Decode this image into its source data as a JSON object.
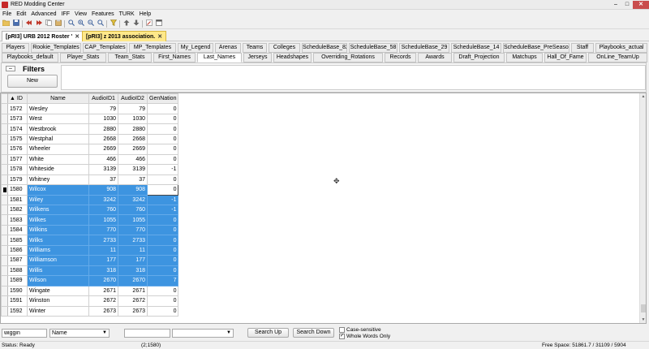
{
  "window": {
    "title": "RED Modding Center",
    "minimize": "–",
    "maximize": "□",
    "close": "✕"
  },
  "menu": [
    "File",
    "Edit",
    "Advanced",
    "IFF",
    "View",
    "Features",
    "TURK",
    "Help"
  ],
  "doc_tabs": [
    {
      "label": "[pRI3] URB 2012 Roster '",
      "close": "✕"
    },
    {
      "label": "[pRI3] z 2013 association.",
      "close": "✕"
    }
  ],
  "tabs_row1": [
    "Players",
    "Rookie_Templates",
    "CAP_Templates",
    "MP_Templates",
    "My_Legend",
    "Arenas",
    "Teams",
    "Colleges",
    "ScheduleBase_82",
    "ScheduleBase_58",
    "ScheduleBase_29",
    "ScheduleBase_14",
    "ScheduleBase_PreSeason",
    "Staff",
    "Playbooks_actual"
  ],
  "tabs_row2": [
    "Playbooks_default",
    "Player_Stats",
    "Team_Stats",
    "First_Names",
    "Last_Names",
    "Jerseys",
    "Headshapes",
    "Overriding_Rotations",
    "Records",
    "Awards",
    "Draft_Projection",
    "Matchups",
    "Hall_Of_Fame",
    "OnLine_TeamUp"
  ],
  "filters": {
    "collapse": "–",
    "label": "Filters",
    "new_button": "New"
  },
  "grid": {
    "sort_indicator": "▲",
    "columns": [
      "ID",
      "Name",
      "AudioID1",
      "AudioID2",
      "GenNation"
    ],
    "rows": [
      {
        "id": "1572",
        "name": "Wesley",
        "a1": "79",
        "a2": "79",
        "gn": "0"
      },
      {
        "id": "1573",
        "name": "West",
        "a1": "1030",
        "a2": "1030",
        "gn": "0"
      },
      {
        "id": "1574",
        "name": "Westbrook",
        "a1": "2880",
        "a2": "2880",
        "gn": "0"
      },
      {
        "id": "1575",
        "name": "Westphal",
        "a1": "2668",
        "a2": "2668",
        "gn": "0"
      },
      {
        "id": "1576",
        "name": "Wheeler",
        "a1": "2669",
        "a2": "2669",
        "gn": "0"
      },
      {
        "id": "1577",
        "name": "White",
        "a1": "466",
        "a2": "466",
        "gn": "0"
      },
      {
        "id": "1578",
        "name": "Whiteside",
        "a1": "3139",
        "a2": "3139",
        "gn": "-1"
      },
      {
        "id": "1579",
        "name": "Whitney",
        "a1": "37",
        "a2": "37",
        "gn": "0"
      },
      {
        "id": "1580",
        "name": "Wilcox",
        "a1": "908",
        "a2": "908",
        "gn": "0"
      },
      {
        "id": "1581",
        "name": "Wiley",
        "a1": "3242",
        "a2": "3242",
        "gn": "-1"
      },
      {
        "id": "1582",
        "name": "Wilkens",
        "a1": "760",
        "a2": "760",
        "gn": "-1"
      },
      {
        "id": "1583",
        "name": "Wilkes",
        "a1": "1055",
        "a2": "1055",
        "gn": "0"
      },
      {
        "id": "1584",
        "name": "Wilkins",
        "a1": "770",
        "a2": "770",
        "gn": "0"
      },
      {
        "id": "1585",
        "name": "Wilks",
        "a1": "2733",
        "a2": "2733",
        "gn": "0"
      },
      {
        "id": "1586",
        "name": "Williams",
        "a1": "11",
        "a2": "11",
        "gn": "0"
      },
      {
        "id": "1587",
        "name": "Williamson",
        "a1": "177",
        "a2": "177",
        "gn": "0"
      },
      {
        "id": "1588",
        "name": "Willis",
        "a1": "318",
        "a2": "318",
        "gn": "0"
      },
      {
        "id": "1589",
        "name": "Wilson",
        "a1": "2670",
        "a2": "2670",
        "gn": "7"
      },
      {
        "id": "1590",
        "name": "Wingate",
        "a1": "2671",
        "a2": "2671",
        "gn": "0"
      },
      {
        "id": "1591",
        "name": "Winston",
        "a1": "2672",
        "a2": "2672",
        "gn": "0"
      },
      {
        "id": "1592",
        "name": "Winter",
        "a1": "2673",
        "a2": "2673",
        "gn": "0"
      }
    ],
    "current_row": "1580",
    "selected_rows": [
      "1580",
      "1581",
      "1582",
      "1583",
      "1584",
      "1585",
      "1586",
      "1587",
      "1588",
      "1589"
    ],
    "scroll_up": "▲",
    "scroll_down": "▼"
  },
  "find": {
    "search_value": "wiggin",
    "field_select": "Name",
    "dropdown_arrow": "▼",
    "value2": "",
    "select2": "",
    "search_up": "Search Up",
    "search_down": "Search Down",
    "case_sensitive": "Case-sensitive",
    "whole_words": "Whole Words Only",
    "check_mark": "✓"
  },
  "status": {
    "status": "Status:  Ready",
    "coords": "(2;1580)",
    "free_space": "Free Space:   51861.7 / 31109 / 5904"
  },
  "colors": {
    "selection": "#3d94e0",
    "active_doc_tab": "#ffe88a",
    "close_button": "#c94c4c"
  }
}
